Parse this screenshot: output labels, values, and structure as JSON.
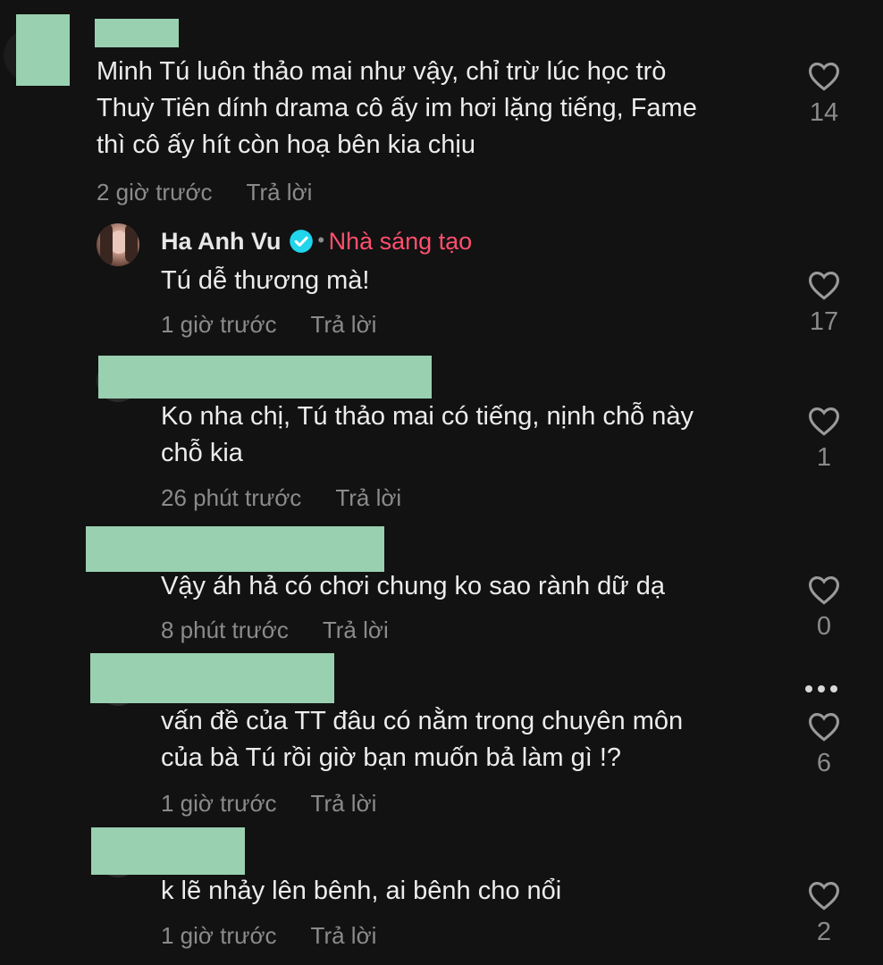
{
  "comments": [
    {
      "text_lines": [
        "Minh Tú luôn thảo mai như vậy, chỉ trừ lúc học trò",
        "Thuỳ Tiên dính drama cô ấy im hơi lặng tiếng, Fame",
        "thì cô ấy hít còn hoạ bên kia chịu"
      ],
      "time": "2 giờ trước",
      "reply": "Trả lời",
      "likes": "14"
    },
    {
      "author": "Ha Anh Vu",
      "badge": "Nhà sáng tạo",
      "text_lines": [
        "Tú dễ thương mà!"
      ],
      "time": "1 giờ trước",
      "reply": "Trả lời",
      "likes": "17"
    },
    {
      "text_lines": [
        "Ko nha chị, Tú thảo mai có tiếng, nịnh chỗ này",
        "chỗ kia"
      ],
      "time": "26 phút trước",
      "reply": "Trả lời",
      "likes": "1"
    },
    {
      "text_lines": [
        "Vậy áh hả có chơi chung ko sao rành dữ dạ"
      ],
      "time": "8 phút trước",
      "reply": "Trả lời",
      "likes": "0"
    },
    {
      "text_lines": [
        "vấn đề của TT đâu có nằm trong chuyên môn",
        "của bà Tú rồi giờ bạn muốn bả làm gì !?"
      ],
      "time": "1 giờ trước",
      "reply": "Trả lời",
      "likes": "6"
    },
    {
      "text_lines": [
        "k lẽ nhảy lên bênh, ai bênh cho nổi"
      ],
      "time": "1 giờ trước",
      "reply": "Trả lời",
      "likes": "2"
    }
  ],
  "colors": {
    "background": "#121212",
    "creator_badge": "#ff4f6e",
    "verified": "#20d5ec",
    "redaction": "#99d0b0"
  },
  "icons": [
    "heart-icon",
    "verified-icon",
    "more-icon"
  ]
}
